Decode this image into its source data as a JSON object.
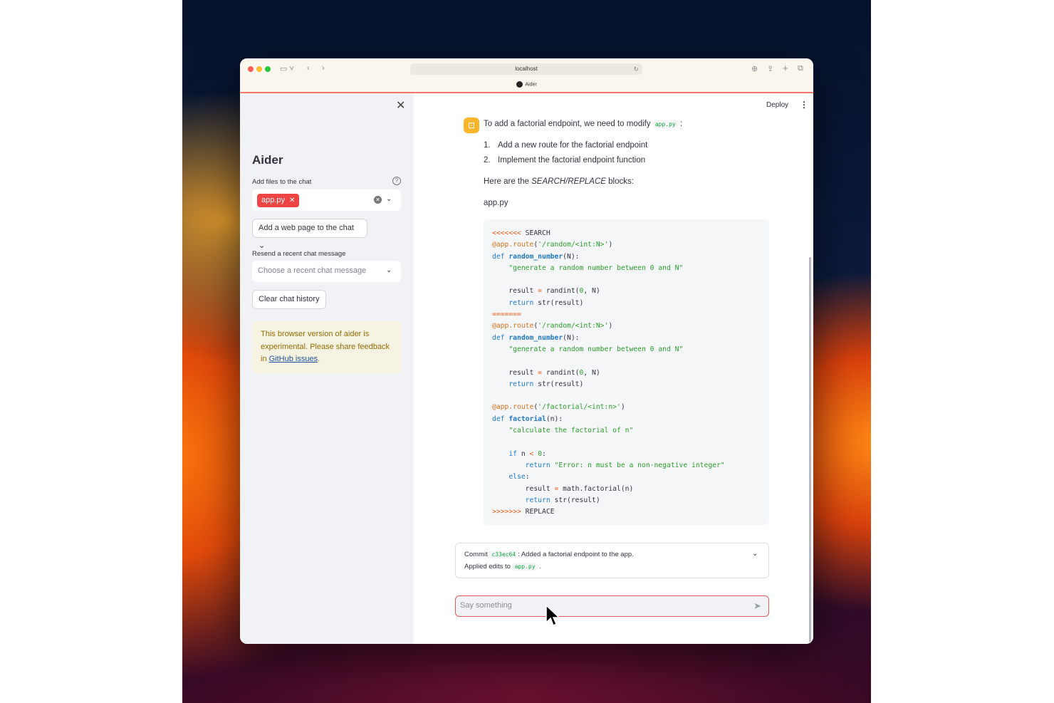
{
  "browser": {
    "url": "localhost",
    "tab_title": "Aider"
  },
  "sidebar": {
    "title": "Aider",
    "add_files_label": "Add files to the chat",
    "selected_file": "app.py",
    "add_web_page_button": "Add a web page to the chat",
    "resend_label": "Resend a recent chat message",
    "resend_placeholder": "Choose a recent chat message",
    "clear_history_button": "Clear chat history",
    "notice_text": "This browser version of aider is experimental. Please share feedback in",
    "notice_link": "GitHub issues",
    "notice_end": "."
  },
  "header": {
    "deploy": "Deploy"
  },
  "message": {
    "intro_before": "To add a factorial endpoint, we need to modify",
    "intro_code": "app.py",
    "intro_after": ":",
    "steps": [
      "Add a new route for the factorial endpoint",
      "Implement the factorial endpoint function"
    ],
    "blocks_before": "Here are the",
    "blocks_em": "SEARCH/REPLACE",
    "blocks_after": "blocks:",
    "filename": "app.py"
  },
  "commit": {
    "label": "Commit",
    "hash": "c33ec64",
    "message": ": Added a factorial endpoint to the app.",
    "applied_label": "Applied edits to",
    "applied_file": "app.py",
    "applied_end": "."
  },
  "chat_input": {
    "placeholder": "Say something"
  },
  "icons": {
    "close": "close-icon",
    "help": "help-icon",
    "send": "send-icon",
    "avatar": "robot-icon"
  },
  "colors": {
    "chip": "#ef4444",
    "avatar": "#fdb52a",
    "notice_text": "#926c05",
    "input_border": "#e05a5a"
  }
}
